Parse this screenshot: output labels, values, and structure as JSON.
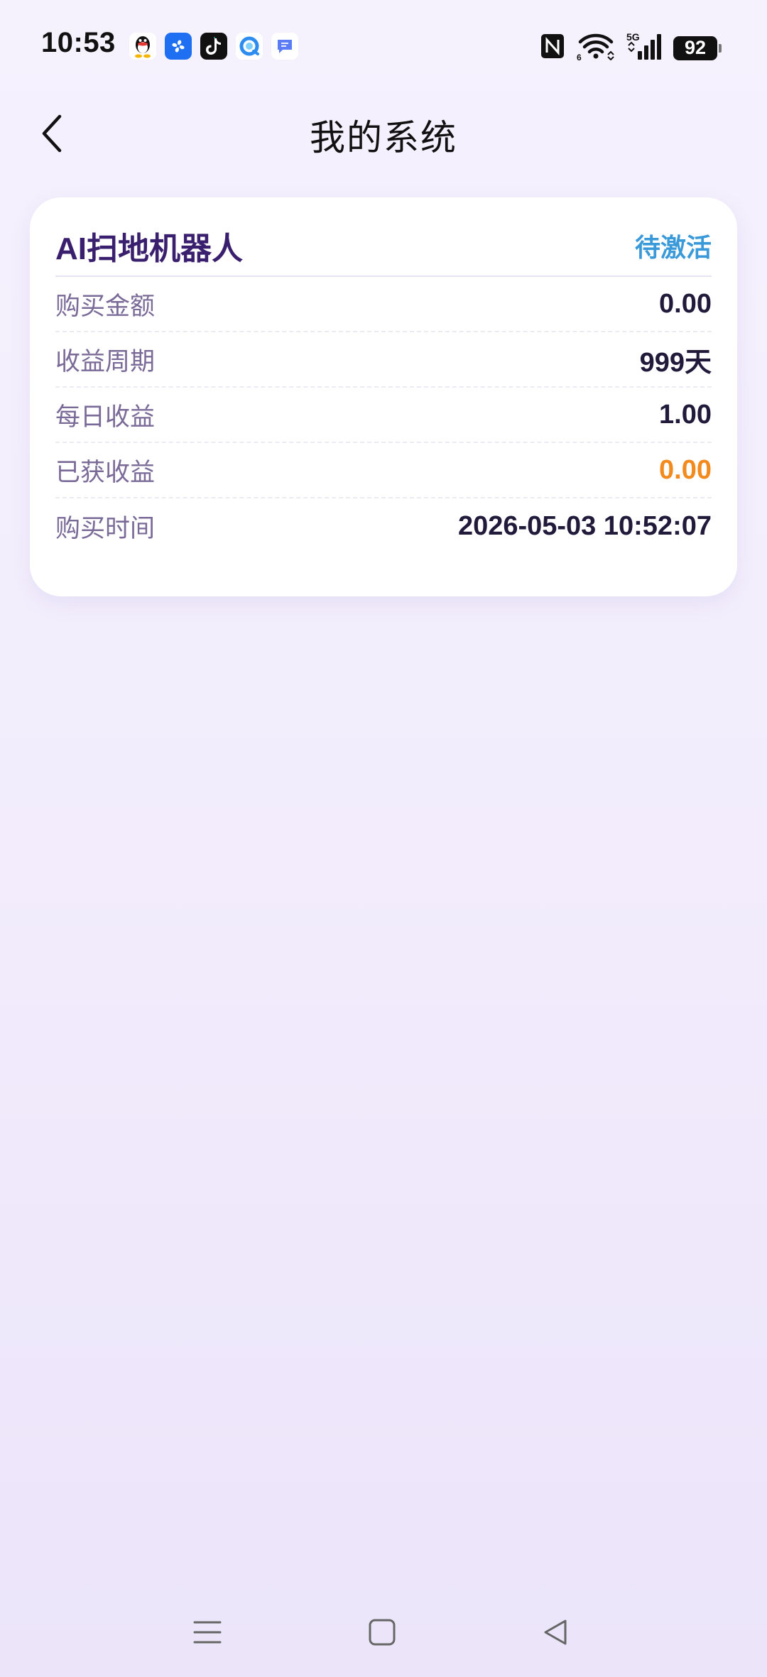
{
  "status_bar": {
    "time": "10:53",
    "battery": "92",
    "notification_icons": [
      "qq-icon",
      "fan-app-icon",
      "tiktok-icon",
      "browser-icon",
      "message-icon"
    ],
    "system_icons": [
      "nfc-icon",
      "wifi-icon",
      "signal-5g-icon",
      "battery-icon"
    ]
  },
  "header": {
    "title": "我的系统"
  },
  "card": {
    "title": "AI扫地机器人",
    "status": "待激活",
    "rows": [
      {
        "label": "购买金额",
        "value": "0.00"
      },
      {
        "label": "收益周期",
        "value": "999天"
      },
      {
        "label": "每日收益",
        "value": "1.00"
      },
      {
        "label": "已获收益",
        "value": "0.00"
      },
      {
        "label": "购买时间",
        "value": "2026-05-03 10:52:07"
      }
    ]
  },
  "colors": {
    "title": "#3a1f6e",
    "status": "#3a9ad9",
    "accent": "#f28a1e",
    "label": "#7a6a98"
  }
}
